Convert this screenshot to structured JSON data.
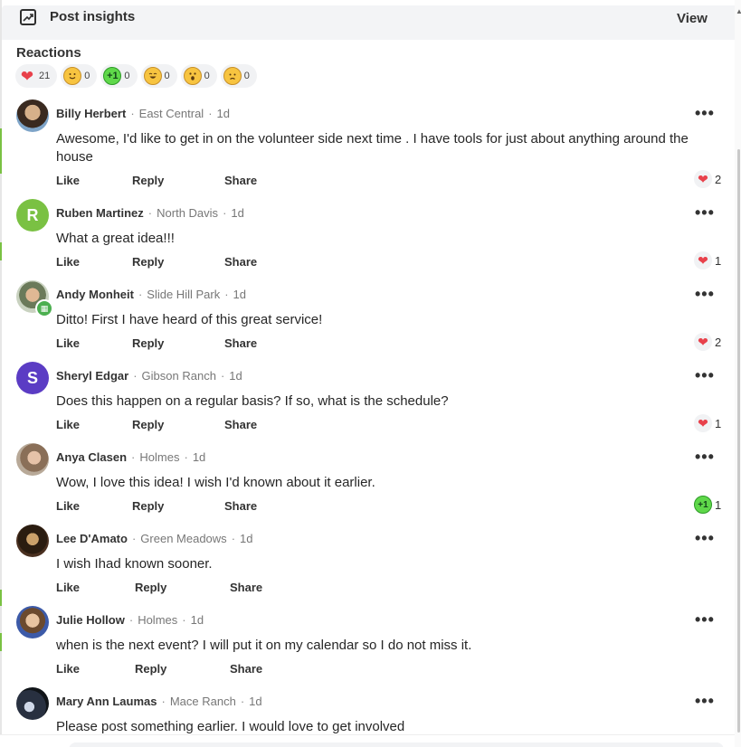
{
  "header": {
    "insights_label": "Post insights",
    "view_label": "View"
  },
  "reactions": {
    "title": "Reactions",
    "items": [
      {
        "icon": "heart-icon",
        "count": "21"
      },
      {
        "icon": "smile-face-icon",
        "count": "0"
      },
      {
        "icon": "plus-one-icon",
        "count": "0"
      },
      {
        "icon": "laugh-face-icon",
        "count": "0"
      },
      {
        "icon": "wow-face-icon",
        "count": "0"
      },
      {
        "icon": "sad-face-icon",
        "count": "0"
      }
    ]
  },
  "actions": {
    "like": "Like",
    "reply": "Reply",
    "share": "Share"
  },
  "comments": [
    {
      "name": "Billy Herbert",
      "hood": "East Central",
      "time": "1d",
      "text": "Awesome, I'd like to get in on the volunteer side next time . I have tools for just about anything around the house",
      "reaction": "2",
      "reaction_icon": "heart-icon"
    },
    {
      "name": "Ruben Martinez",
      "hood": "North Davis",
      "time": "1d",
      "text": "What a great idea!!!",
      "reaction": "1",
      "reaction_icon": "heart-icon",
      "avatar_letter": "R"
    },
    {
      "name": "Andy Monheit",
      "hood": "Slide Hill Park",
      "time": "1d",
      "text": "Ditto! First I have heard of this great service!",
      "reaction": "2",
      "reaction_icon": "heart-icon"
    },
    {
      "name": "Sheryl Edgar",
      "hood": "Gibson Ranch",
      "time": "1d",
      "text": "Does this happen on a regular basis?  If so, what is the schedule?",
      "reaction": "1",
      "reaction_icon": "heart-icon",
      "avatar_letter": "S"
    },
    {
      "name": "Anya Clasen",
      "hood": "Holmes",
      "time": "1d",
      "text": "Wow, I love this idea!  I wish I'd known about it earlier.",
      "reaction": "1",
      "reaction_icon": "plus-one-icon"
    },
    {
      "name": "Lee D'Amato",
      "hood": "Green Meadows",
      "time": "1d",
      "text": "I wish Ihad known sooner."
    },
    {
      "name": "Julie Hollow",
      "hood": "Holmes",
      "time": "1d",
      "text": "when is the next event? I will put it on my calendar so I do not miss it."
    },
    {
      "name": "Mary Ann Laumas",
      "hood": "Mace Ranch",
      "time": "1d",
      "text": "Please post something earlier. I would love to get involved"
    }
  ],
  "colors": {
    "accent_green": "#7ac143",
    "heart_red": "#e8414b",
    "avatar_r": "#7ac143",
    "avatar_s": "#5b3cc4"
  }
}
